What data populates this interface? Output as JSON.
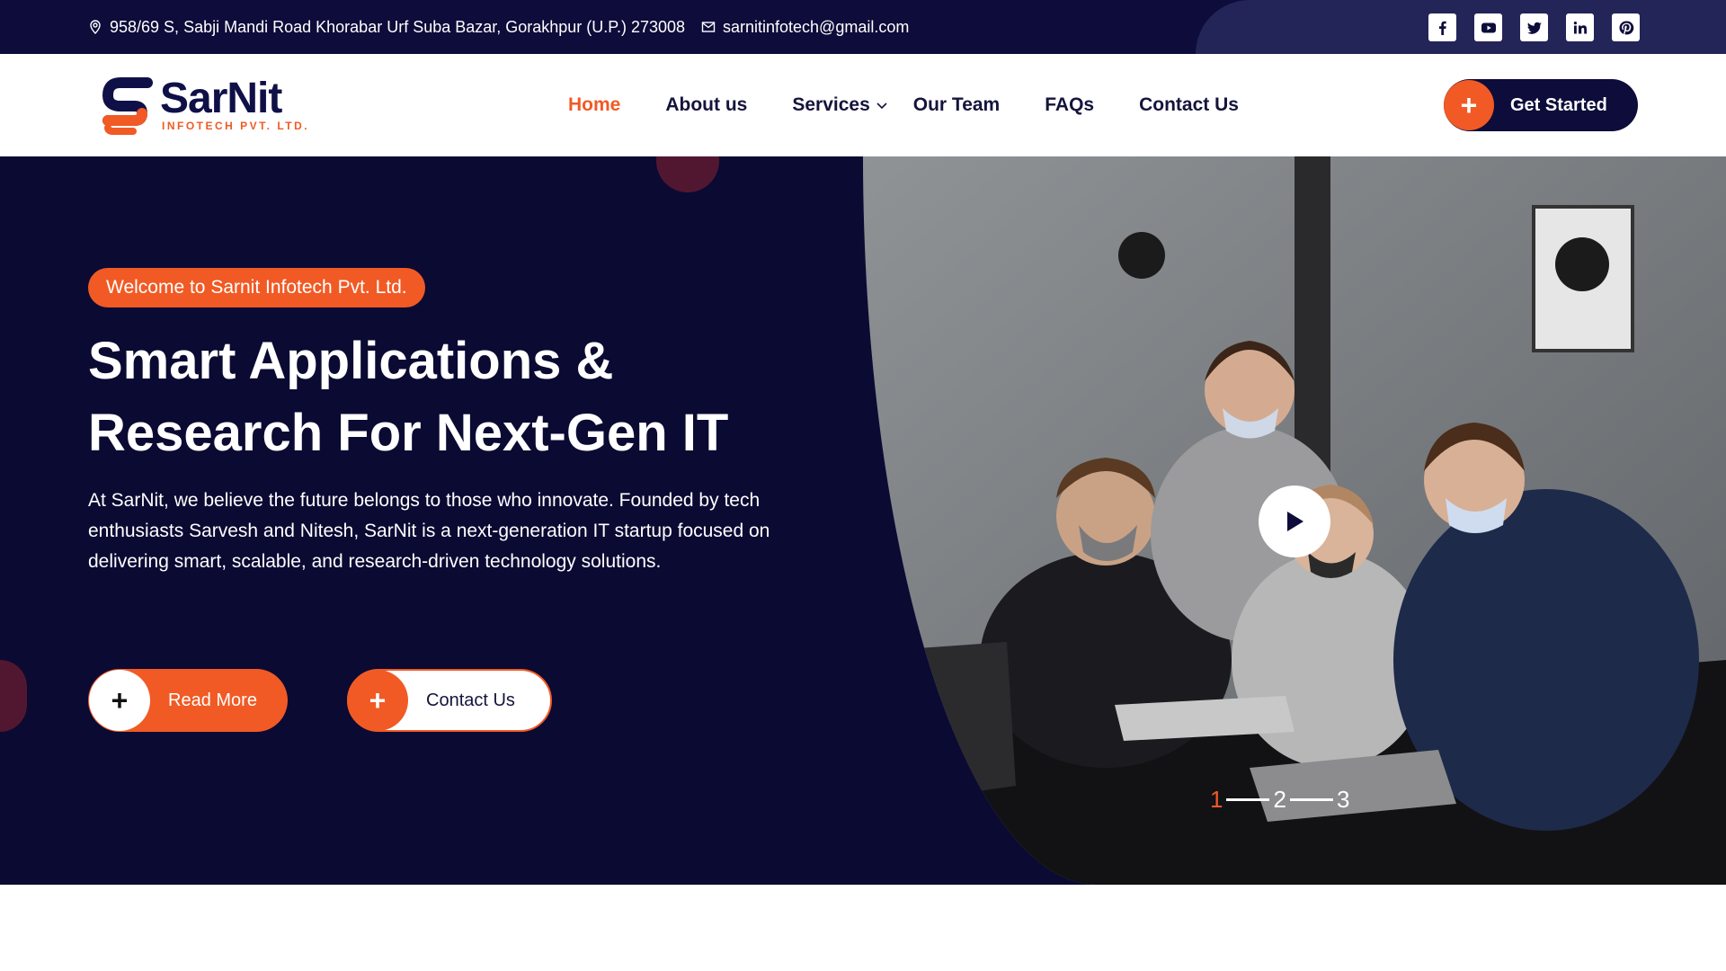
{
  "topbar": {
    "address": "958/69 S, Sabji Mandi Road Khorabar Urf Suba Bazar, Gorakhpur (U.P.) 273008",
    "email": "sarnitinfotech@gmail.com",
    "socials": [
      "facebook-icon",
      "youtube-icon",
      "twitter-icon",
      "linkedin-icon",
      "pinterest-icon"
    ]
  },
  "header": {
    "logo_name": "SarNit",
    "logo_sub": "INFOTECH PVT. LTD.",
    "nav": [
      {
        "label": "Home",
        "active": true
      },
      {
        "label": "About us"
      },
      {
        "label": "Services",
        "dropdown": true
      },
      {
        "label": "Our Team"
      },
      {
        "label": "FAQs"
      },
      {
        "label": "Contact Us"
      }
    ],
    "cta_label": "Get Started"
  },
  "hero": {
    "badge": "Welcome to Sarnit Infotech Pvt. Ltd.",
    "headline_line1": "Smart Applications &",
    "headline_line2": "Research For Next-Gen IT",
    "description": "At SarNit, we believe the future belongs to those who innovate. Founded by tech enthusiasts Sarvesh and Nitesh, SarNit is a next-generation IT startup focused on delivering smart, scalable, and research-driven technology solutions.",
    "read_more": "Read More",
    "contact_us": "Contact Us",
    "pager": [
      "1",
      "2",
      "3"
    ],
    "active_slide": "1"
  },
  "colors": {
    "accent": "#f15a24",
    "navy": "#0d0c3a"
  }
}
